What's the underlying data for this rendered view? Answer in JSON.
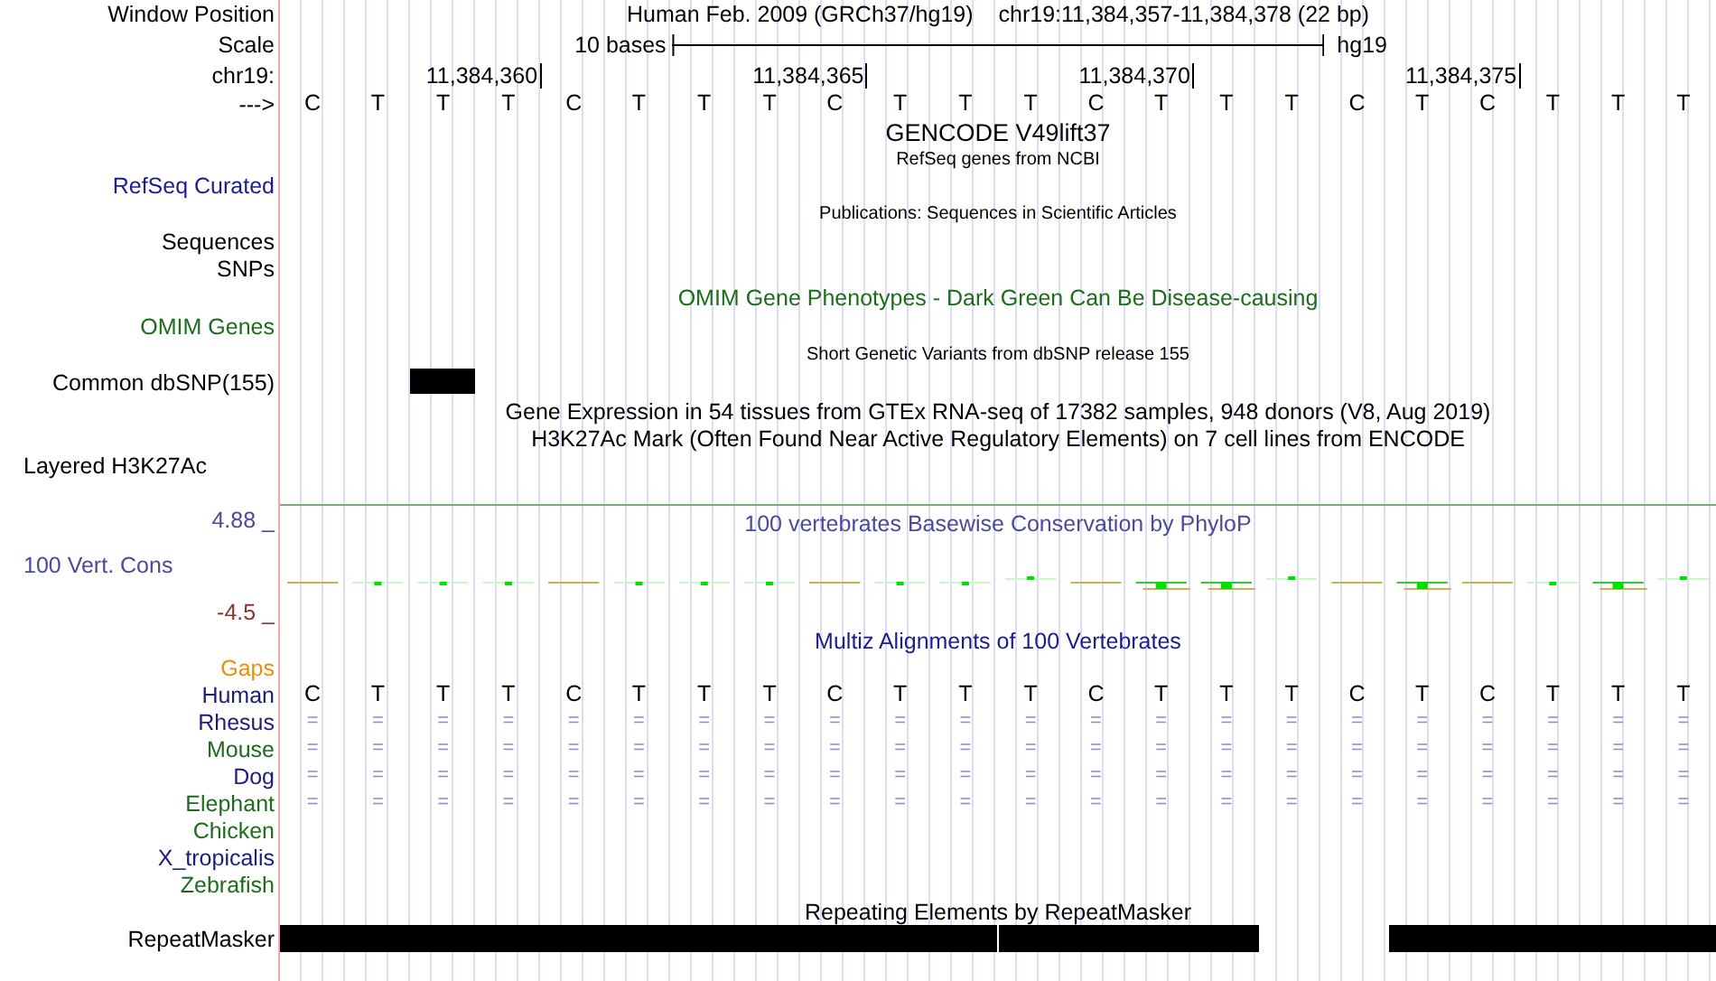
{
  "header": {
    "label": "Window Position",
    "assembly": "Human Feb. 2009 (GRCh37/hg19)",
    "position": "chr19:11,384,357-11,384,378 (22 bp)"
  },
  "scale": {
    "label": "Scale",
    "text": "10 bases",
    "db": "hg19"
  },
  "ruler": {
    "label": "chr19:",
    "strand": "--->"
  },
  "bases": [
    {
      "base": "C",
      "repeat": true,
      "common_snp": false
    },
    {
      "base": "T",
      "repeat": true,
      "common_snp": false
    },
    {
      "base": "T",
      "repeat": true,
      "common_snp": true
    },
    {
      "base": "T",
      "repeat": true,
      "common_snp": false,
      "tick": "11,384,360"
    },
    {
      "base": "C",
      "repeat": true,
      "common_snp": false
    },
    {
      "base": "T",
      "repeat": true,
      "common_snp": false
    },
    {
      "base": "T",
      "repeat": true,
      "common_snp": false
    },
    {
      "base": "T",
      "repeat": true,
      "common_snp": false
    },
    {
      "base": "C",
      "repeat": true,
      "common_snp": false,
      "tick": "11,384,365"
    },
    {
      "base": "T",
      "repeat": true,
      "common_snp": false
    },
    {
      "base": "T",
      "repeat": true,
      "common_snp": false
    },
    {
      "base": "T",
      "repeat": true,
      "common_snp": false
    },
    {
      "base": "C",
      "repeat": true,
      "common_snp": false
    },
    {
      "base": "T",
      "repeat": true,
      "common_snp": false,
      "tick": "11,384,370"
    },
    {
      "base": "T",
      "repeat": true,
      "common_snp": false
    },
    {
      "base": "T",
      "repeat": false,
      "common_snp": false
    },
    {
      "base": "C",
      "repeat": false,
      "common_snp": false
    },
    {
      "base": "T",
      "repeat": true,
      "common_snp": false
    },
    {
      "base": "C",
      "repeat": true,
      "common_snp": false,
      "tick": "11,384,375"
    },
    {
      "base": "T",
      "repeat": true,
      "common_snp": false
    },
    {
      "base": "T",
      "repeat": true,
      "common_snp": false
    },
    {
      "base": "T",
      "repeat": true,
      "common_snp": false
    }
  ],
  "gencode": {
    "title": "GENCODE V49lift37"
  },
  "refseq": {
    "title": "RefSeq genes from NCBI",
    "label": "RefSeq Curated"
  },
  "publications": {
    "title": "Publications: Sequences in Scientific Articles",
    "label": "Sequences"
  },
  "snps": {
    "label": "SNPs"
  },
  "omim": {
    "title": "OMIM Gene Phenotypes - Dark Green Can Be Disease-causing",
    "label": "OMIM Genes"
  },
  "dbsnp": {
    "title": "Short Genetic Variants from dbSNP release 155",
    "label": "Common dbSNP(155)"
  },
  "gtex": {
    "title": "Gene Expression in 54 tissues from GTEx RNA-seq of 17382 samples, 948 donors (V8, Aug 2019)"
  },
  "h3k27ac": {
    "title": "H3K27Ac Mark (Often Found Near Active Regulatory Elements) on 7 cell lines from ENCODE",
    "label": "Layered H3K27Ac"
  },
  "conservation": {
    "title": "100 vertebrates Basewise Conservation by PhyloP",
    "label": "100 Vert. Cons",
    "max": "4.88 _",
    "min": "-4.5 _"
  },
  "multiz": {
    "title": "Multiz Alignments of 100 Vertebrates",
    "gaps_label": "Gaps",
    "species": [
      {
        "name": "Human",
        "color": "#1c1c7c",
        "bases": [
          "C",
          "T",
          "T",
          "T",
          "C",
          "T",
          "T",
          "T",
          "C",
          "T",
          "T",
          "T",
          "C",
          "T",
          "T",
          "T",
          "C",
          "T",
          "C",
          "T",
          "T",
          "T"
        ]
      },
      {
        "name": "Rhesus",
        "color": "#1c1c7c",
        "bases": [
          "=",
          "=",
          "=",
          "=",
          "=",
          "=",
          "=",
          "=",
          "=",
          "=",
          "=",
          "=",
          "=",
          "=",
          "=",
          "=",
          "=",
          "=",
          "=",
          "=",
          "=",
          "="
        ]
      },
      {
        "name": "Mouse",
        "color": "#1c6c1c",
        "bases": [
          "=",
          "=",
          "=",
          "=",
          "=",
          "=",
          "=",
          "=",
          "=",
          "=",
          "=",
          "=",
          "=",
          "=",
          "=",
          "=",
          "=",
          "=",
          "=",
          "=",
          "=",
          "="
        ]
      },
      {
        "name": "Dog",
        "color": "#1c1c7c",
        "bases": [
          "=",
          "=",
          "=",
          "=",
          "=",
          "=",
          "=",
          "=",
          "=",
          "=",
          "=",
          "=",
          "=",
          "=",
          "=",
          "=",
          "=",
          "=",
          "=",
          "=",
          "=",
          "="
        ]
      },
      {
        "name": "Elephant",
        "color": "#1c6c1c",
        "bases": [
          "=",
          "=",
          "=",
          "=",
          "=",
          "=",
          "=",
          "=",
          "=",
          "=",
          "=",
          "=",
          "=",
          "=",
          "=",
          "=",
          "=",
          "=",
          "=",
          "=",
          "=",
          "="
        ]
      },
      {
        "name": "Chicken",
        "color": "#1c6c1c"
      },
      {
        "name": "X_tropicalis",
        "color": "#1c1c7c"
      },
      {
        "name": "Zebrafish",
        "color": "#1c6c1c"
      }
    ]
  },
  "repeatmasker": {
    "title": "Repeating Elements by RepeatMasker",
    "label": "RepeatMasker"
  }
}
